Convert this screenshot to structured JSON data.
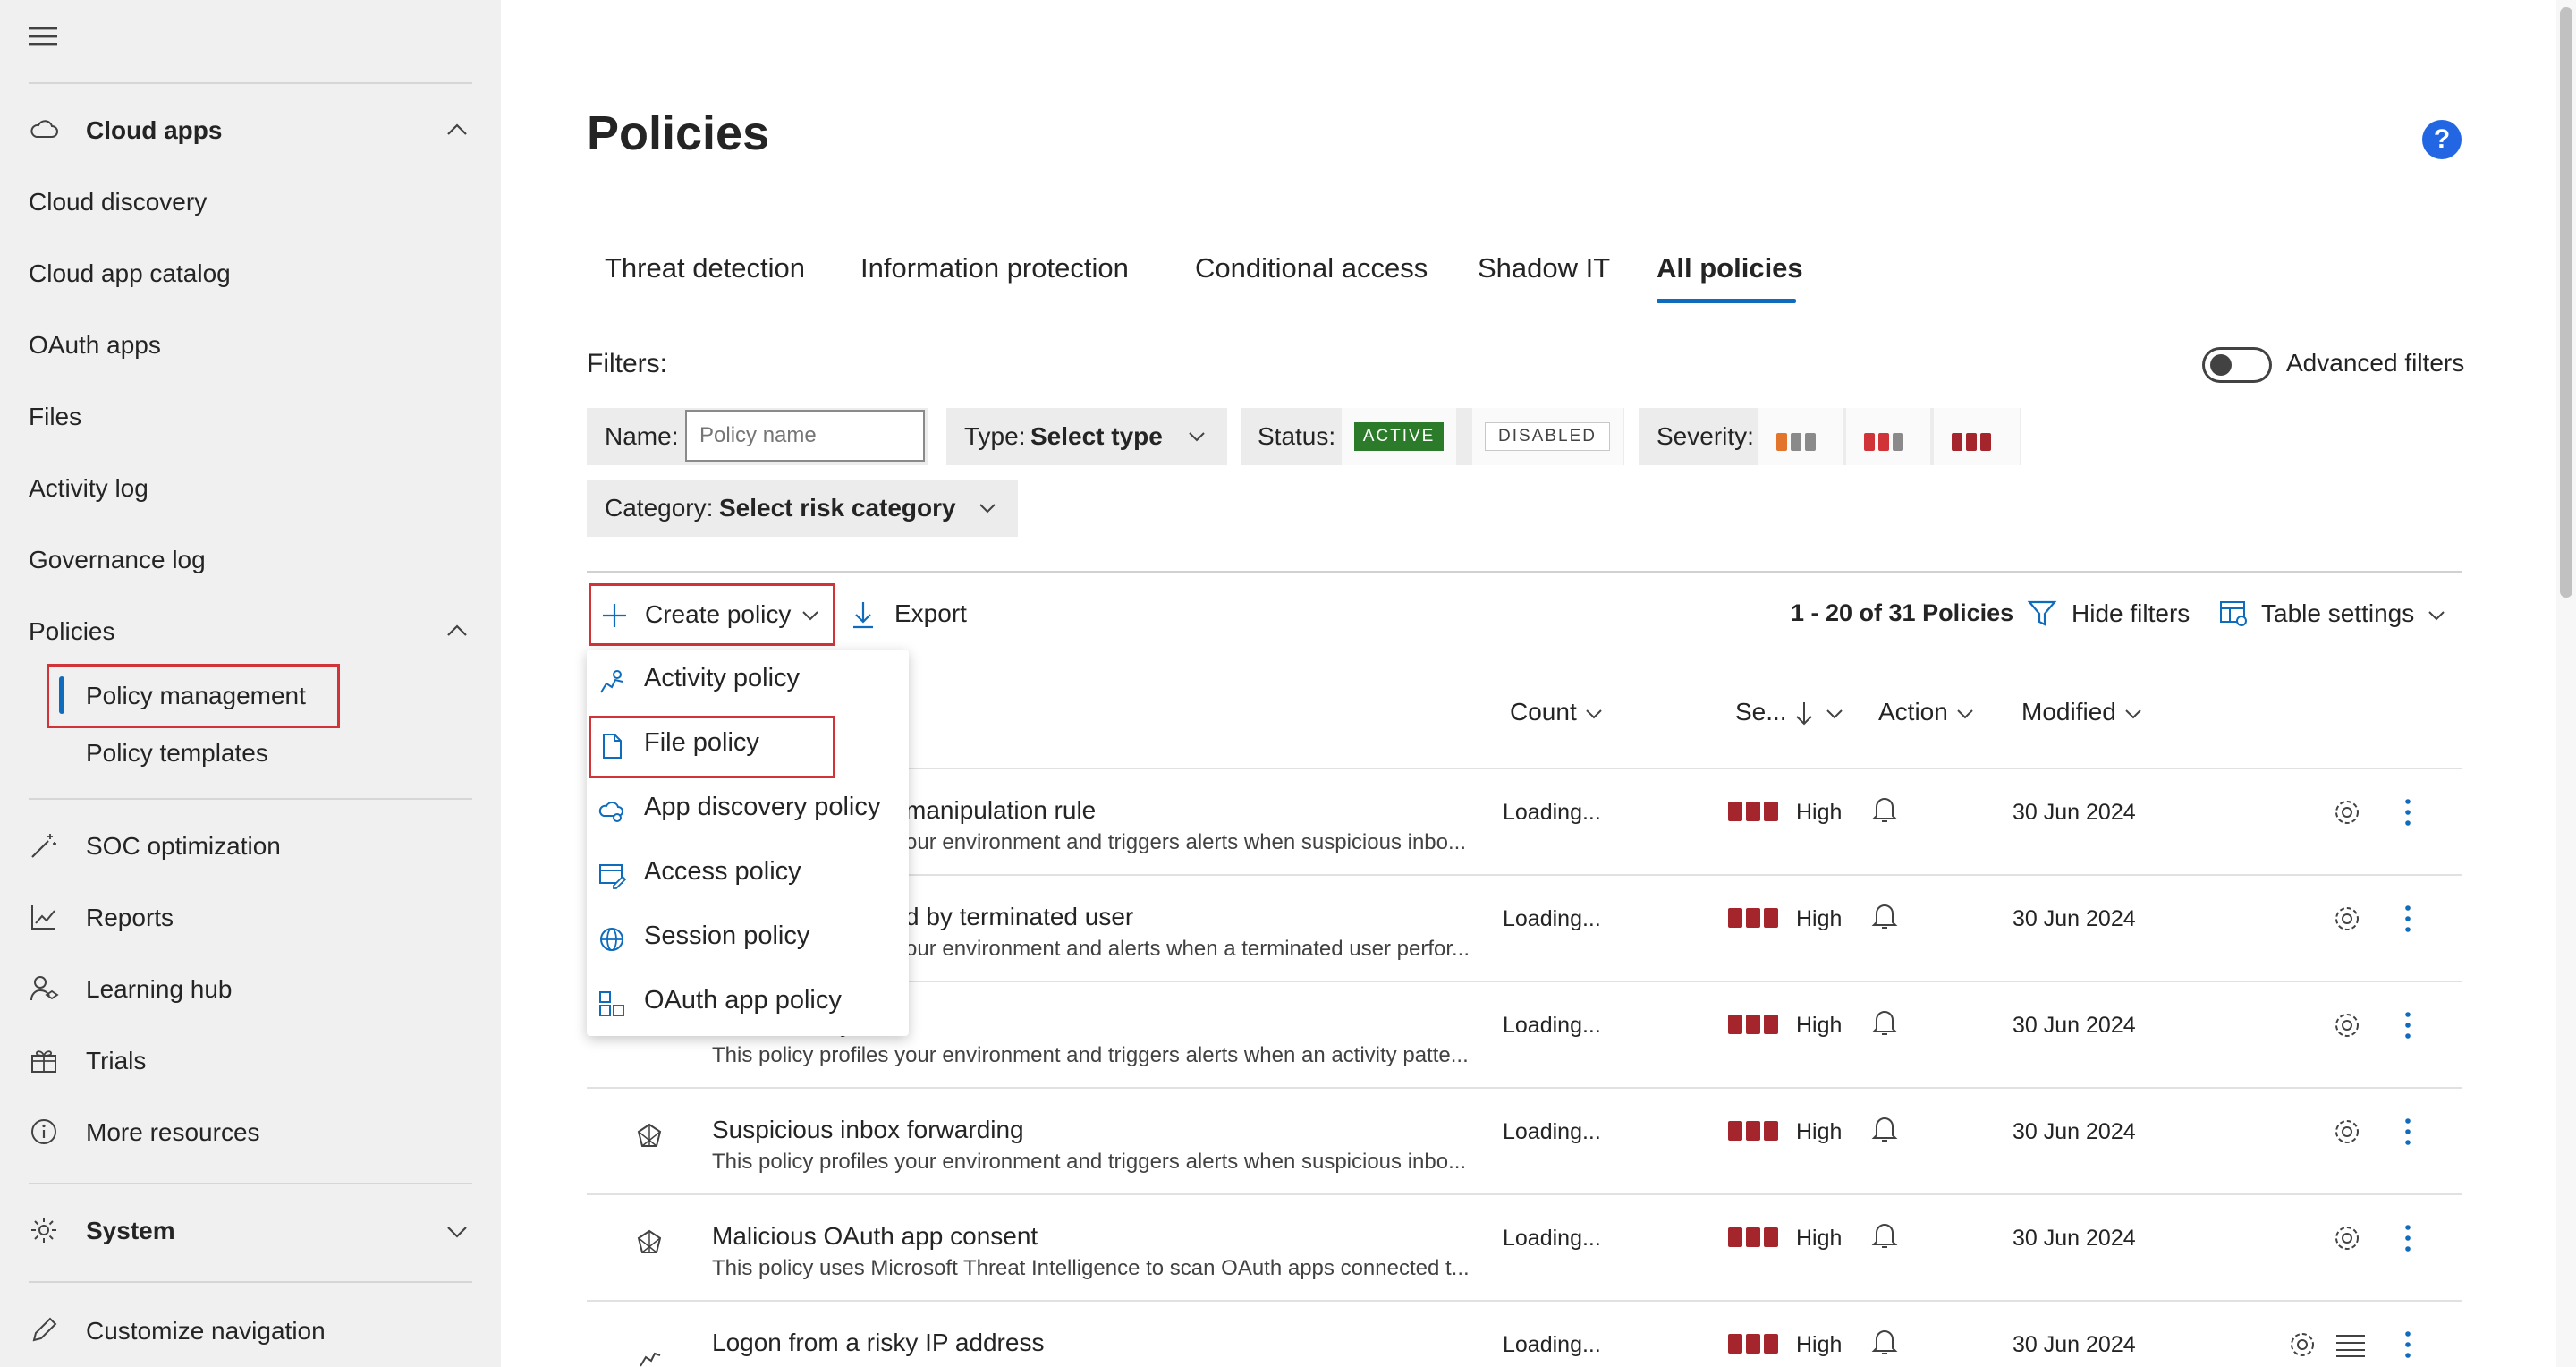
{
  "sidebar": {
    "cloud_apps": "Cloud apps",
    "items": [
      "Cloud discovery",
      "Cloud app catalog",
      "OAuth apps",
      "Files",
      "Activity log",
      "Governance log"
    ],
    "policies": "Policies",
    "policy_management": "Policy management",
    "policy_templates": "Policy templates",
    "soc_optimization": "SOC optimization",
    "reports": "Reports",
    "learning_hub": "Learning hub",
    "trials": "Trials",
    "more_resources": "More resources",
    "system": "System",
    "customize_navigation": "Customize navigation"
  },
  "page": {
    "title": "Policies",
    "help": "?"
  },
  "tabs": [
    "Threat detection",
    "Information protection",
    "Conditional access",
    "Shadow IT",
    "All policies"
  ],
  "active_tab": "All policies",
  "filters": {
    "label": "Filters:",
    "advanced": "Advanced filters",
    "name_label": "Name:",
    "name_placeholder": "Policy name",
    "type_label": "Type:",
    "type_value": "Select type",
    "status_label": "Status:",
    "status_active": "ACTIVE",
    "status_disabled": "DISABLED",
    "severity_label": "Severity:",
    "category_label": "Category:",
    "category_value": "Select risk category"
  },
  "toolbar": {
    "create_policy": "Create policy",
    "export": "Export",
    "count_text": "1 - 20 of 31 Policies",
    "hide_filters": "Hide filters",
    "table_settings": "Table settings"
  },
  "dropdown": {
    "items": [
      "Activity policy",
      "File policy",
      "App discovery policy",
      "Access policy",
      "Session policy",
      "OAuth app policy"
    ],
    "highlighted": "File policy"
  },
  "table": {
    "headers": {
      "count": "Count",
      "severity": "Se...",
      "action": "Action",
      "modified": "Modified"
    },
    "rows": [
      {
        "title": "manipulation rule",
        "desc": "our environment and triggers alerts when suspicious inbo...",
        "count": "Loading...",
        "severity": "High",
        "modified": "30 Jun 2024"
      },
      {
        "title": "d by terminated user",
        "desc": "our environment and alerts when a terminated user perfor...",
        "count": "Loading...",
        "severity": "High",
        "modified": "30 Jun 2024"
      },
      {
        "title": "rity",
        "desc": "This policy profiles your environment and triggers alerts when an activity patte...",
        "count": "Loading...",
        "severity": "High",
        "modified": "30 Jun 2024"
      },
      {
        "title": "Suspicious inbox forwarding",
        "desc": "This policy profiles your environment and triggers alerts when suspicious inbo...",
        "count": "Loading...",
        "severity": "High",
        "modified": "30 Jun 2024"
      },
      {
        "title": "Malicious OAuth app consent",
        "desc": "This policy uses Microsoft Threat Intelligence to scan OAuth apps connected t...",
        "count": "Loading...",
        "severity": "High",
        "modified": "30 Jun 2024"
      },
      {
        "title": "Logon from a risky IP address",
        "desc": "",
        "count": "Loading...",
        "severity": "High",
        "modified": "30 Jun 2024"
      }
    ]
  },
  "colors": {
    "accent": "#0f6cbd",
    "active_green": "#107c10",
    "severity_high": "#a4262c",
    "highlight_red": "#d13438",
    "sidebar_bg": "#f0f0f0"
  }
}
